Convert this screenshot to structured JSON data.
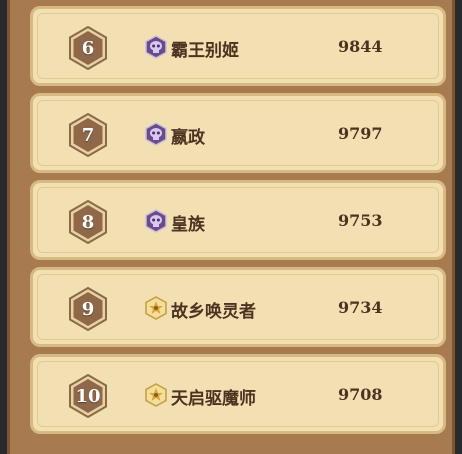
{
  "leaderboard": {
    "rows": [
      {
        "rank": "6",
        "name": "霸王别姬",
        "score": "9844",
        "icon": "purple-skull-crest-icon"
      },
      {
        "rank": "7",
        "name": "嬴政",
        "score": "9797",
        "icon": "purple-skull-crest-icon"
      },
      {
        "rank": "8",
        "name": "皇族",
        "score": "9753",
        "icon": "purple-skull-crest-icon"
      },
      {
        "rank": "9",
        "name": "故乡唤灵者",
        "score": "9734",
        "icon": "gold-crest-icon"
      },
      {
        "rank": "10",
        "name": "天启驱魔师",
        "score": "9708",
        "icon": "gold-crest-icon"
      }
    ]
  },
  "colors": {
    "row_bg": "#f3e0b2",
    "row_border": "#d7b982",
    "rank_badge": "#8e6848",
    "text": "#4a3320",
    "panel": "#a87a4f"
  }
}
